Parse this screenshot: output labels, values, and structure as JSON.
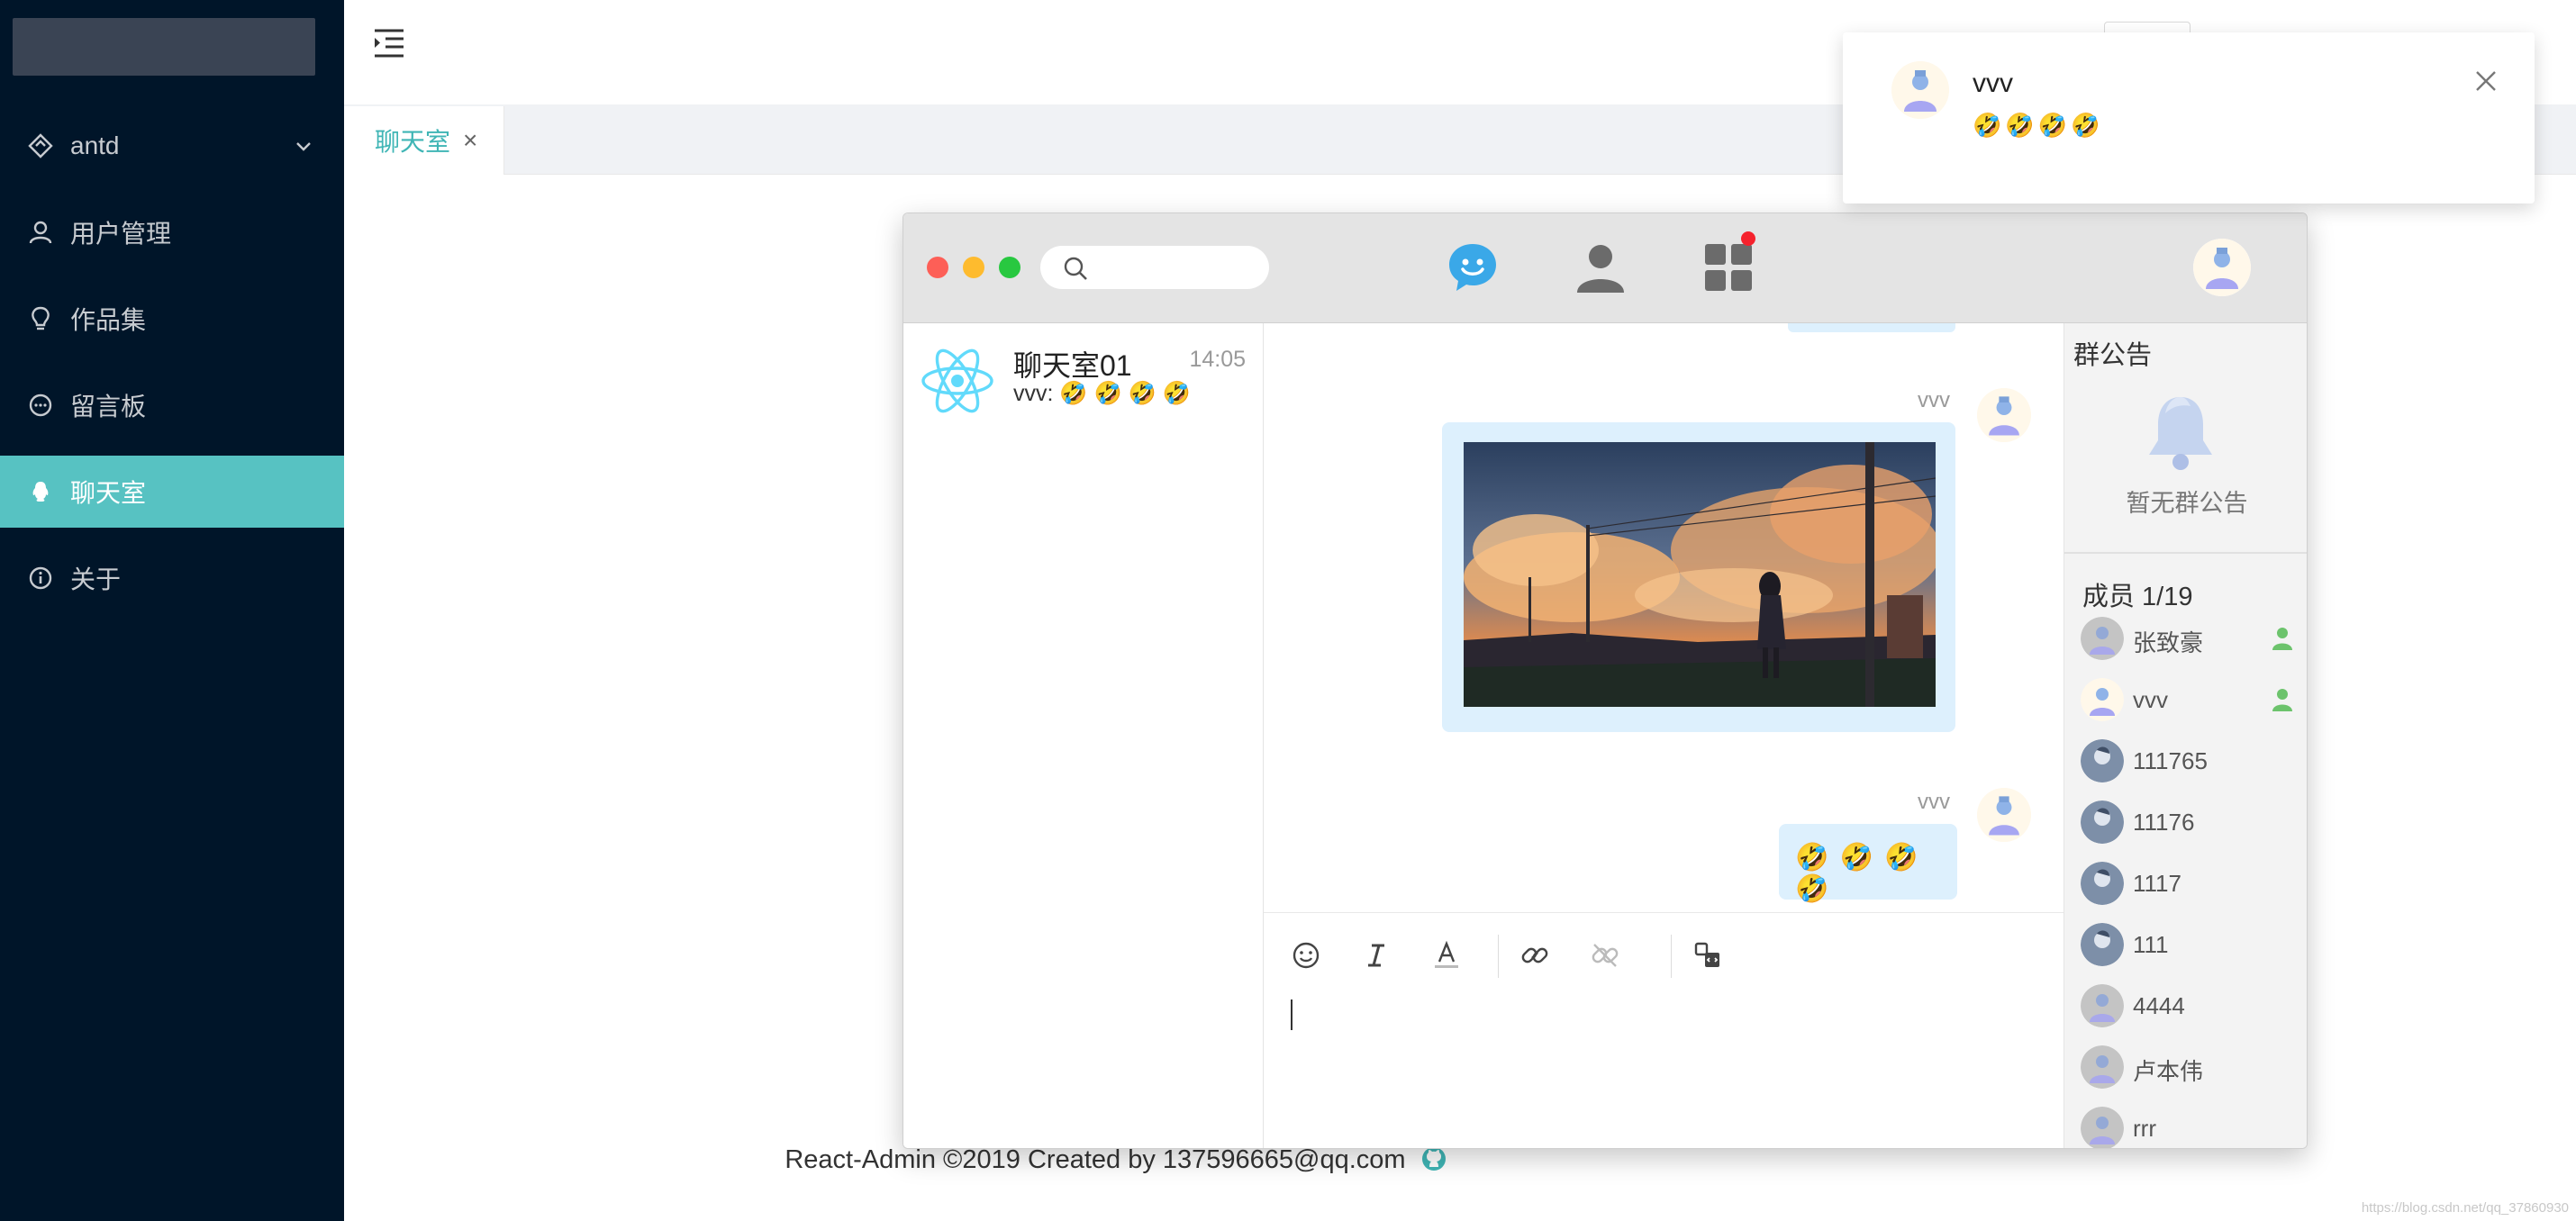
{
  "sidebar": {
    "items": [
      {
        "label": "antd",
        "icon": "diamond-icon"
      },
      {
        "label": "用户管理",
        "icon": "user-icon"
      },
      {
        "label": "作品集",
        "icon": "bulb-icon"
      },
      {
        "label": "留言板",
        "icon": "message-icon"
      },
      {
        "label": "聊天室",
        "icon": "qq-icon"
      },
      {
        "label": "关于",
        "icon": "info-icon"
      }
    ]
  },
  "tabs": [
    {
      "label": "聊天室",
      "close": "×"
    }
  ],
  "chat": {
    "conversation": {
      "name": "聊天室01",
      "time": "14:05",
      "last_message": "vvv: 🤣 🤣 🤣 🤣"
    },
    "messages": [
      {
        "sender": "vvv",
        "type": "image"
      },
      {
        "sender": "vvv",
        "type": "text",
        "text": "🤣 🤣 🤣 🤣"
      }
    ],
    "notice": {
      "title": "群公告",
      "empty_text": "暂无群公告"
    },
    "members": {
      "title": "成员 1/19",
      "list": [
        {
          "name": "张致豪",
          "online": true
        },
        {
          "name": "vvv",
          "online": true
        },
        {
          "name": "111765",
          "online": false
        },
        {
          "name": "11176",
          "online": false
        },
        {
          "name": "1117",
          "online": false
        },
        {
          "name": "111",
          "online": false
        },
        {
          "name": "4444",
          "online": false
        },
        {
          "name": "卢本伟",
          "online": false
        },
        {
          "name": "rrr",
          "online": false
        }
      ]
    }
  },
  "notification": {
    "title": "vvv",
    "body": "🤣🤣🤣🤣"
  },
  "footer": {
    "text": "React-Admin ©2019 Created by 137596665@qq.com"
  },
  "watermark": "https://blog.csdn.net/qq_37860930",
  "colors": {
    "sidebar_bg": "#001529",
    "accent": "#57c2c2",
    "bubble": "#ddf0fd",
    "chat_blue": "#3aa8e8"
  }
}
